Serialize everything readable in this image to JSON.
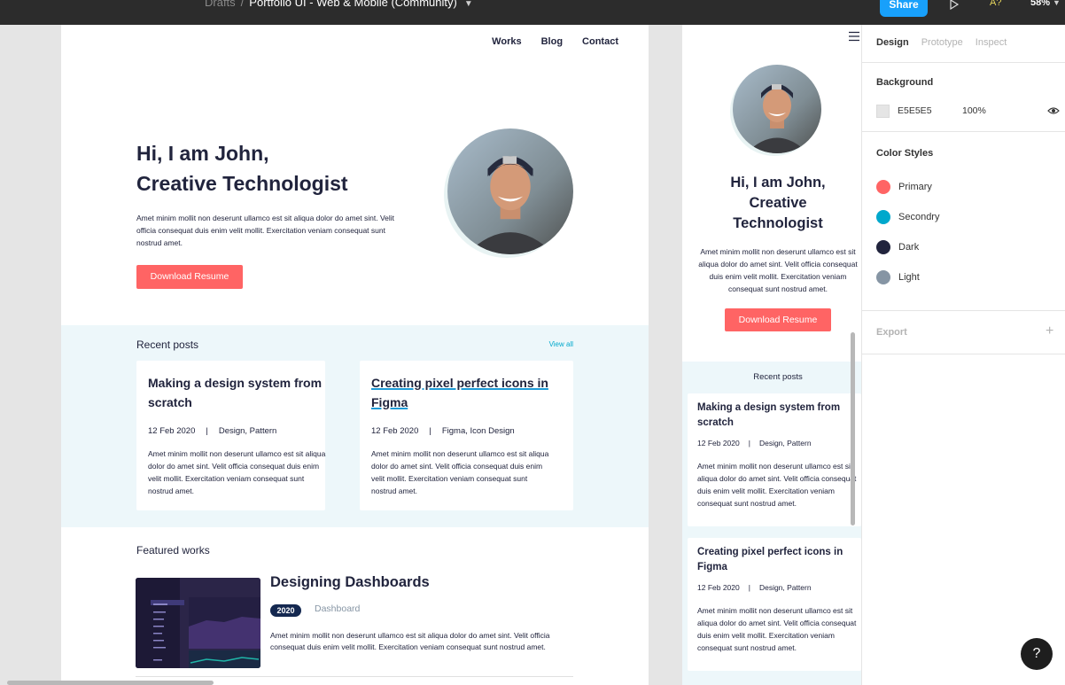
{
  "topbar": {
    "breadcrumb_root": "Drafts",
    "separator": "/",
    "file_name": "Portfolio UI - Web & Mobile (Community)",
    "share_label": "Share",
    "accessibility_label": "A?",
    "zoom": "58%",
    "icons": [
      "chevron-down-icon",
      "play-icon"
    ]
  },
  "desktop": {
    "nav": [
      "Works",
      "Blog",
      "Contact"
    ],
    "hero_line1": "Hi, I am John,",
    "hero_line2": "Creative Technologist",
    "hero_text": "Amet minim mollit non deserunt ullamco est sit aliqua dolor do amet sint. Velit officia consequat duis enim velit mollit. Exercitation veniam consequat sunt nostrud amet.",
    "cta": "Download Resume",
    "recent_heading": "Recent posts",
    "view_all": "View all",
    "posts": [
      {
        "title": "Making a design system from scratch",
        "date": "12 Feb 2020",
        "sep": "|",
        "tags": "Design, Pattern",
        "body": "Amet minim mollit non deserunt ullamco est sit aliqua dolor do amet sint. Velit officia consequat duis enim velit mollit. Exercitation veniam consequat sunt nostrud amet."
      },
      {
        "title": "Creating pixel perfect icons in Figma",
        "date": "12 Feb 2020",
        "sep": "|",
        "tags": "Figma, Icon Design",
        "body": "Amet minim mollit non deserunt ullamco est sit aliqua dolor do amet sint. Velit officia consequat duis enim velit mollit. Exercitation veniam consequat sunt nostrud amet."
      }
    ],
    "featured_heading": "Featured works",
    "featured": {
      "title": "Designing Dashboards",
      "year": "2020",
      "tag": "Dashboard",
      "body": "Amet minim mollit non deserunt ullamco est sit aliqua dolor do amet sint. Velit officia consequat duis enim velit mollit. Exercitation veniam consequat sunt nostrud amet."
    }
  },
  "mobile": {
    "hero_line1": "Hi, I am John,",
    "hero_line2": "Creative",
    "hero_line3": "Technologist",
    "hero_text": "Amet minim mollit non deserunt ullamco est sit aliqua dolor do amet sint. Velit officia consequat duis enim velit mollit. Exercitation veniam consequat sunt nostrud amet.",
    "cta": "Download Resume",
    "recent_heading": "Recent posts",
    "posts": [
      {
        "title": "Making a design system from scratch",
        "date": "12 Feb 2020",
        "sep": "|",
        "tags": "Design, Pattern",
        "body": "Amet minim mollit non deserunt ullamco est sit aliqua dolor do amet sint. Velit officia consequat duis enim velit mollit. Exercitation veniam consequat sunt nostrud amet."
      },
      {
        "title": "Creating pixel perfect icons in Figma",
        "date": "12 Feb 2020",
        "sep": "|",
        "tags": "Design, Pattern",
        "body": "Amet minim mollit non deserunt ullamco est sit aliqua dolor do amet sint. Velit officia consequat duis enim velit mollit. Exercitation veniam consequat sunt nostrud amet."
      }
    ]
  },
  "panel": {
    "tabs": [
      "Design",
      "Prototype",
      "Inspect"
    ],
    "background_heading": "Background",
    "background_hex": "E5E5E5",
    "background_opacity": "100%",
    "color_styles_heading": "Color Styles",
    "color_styles": [
      {
        "name": "Primary",
        "color": "#ff6464"
      },
      {
        "name": "Secondry",
        "color": "#00a8cc"
      },
      {
        "name": "Dark",
        "color": "#21243d"
      },
      {
        "name": "Light",
        "color": "#8695a4"
      }
    ],
    "export_label": "Export",
    "help": "?"
  },
  "colors": {
    "accent": "#18a0fb",
    "primary": "#ff6464",
    "secondary": "#00a8cc",
    "dark": "#21243d",
    "light": "#8695a4",
    "section_bg": "#edf7fa"
  }
}
